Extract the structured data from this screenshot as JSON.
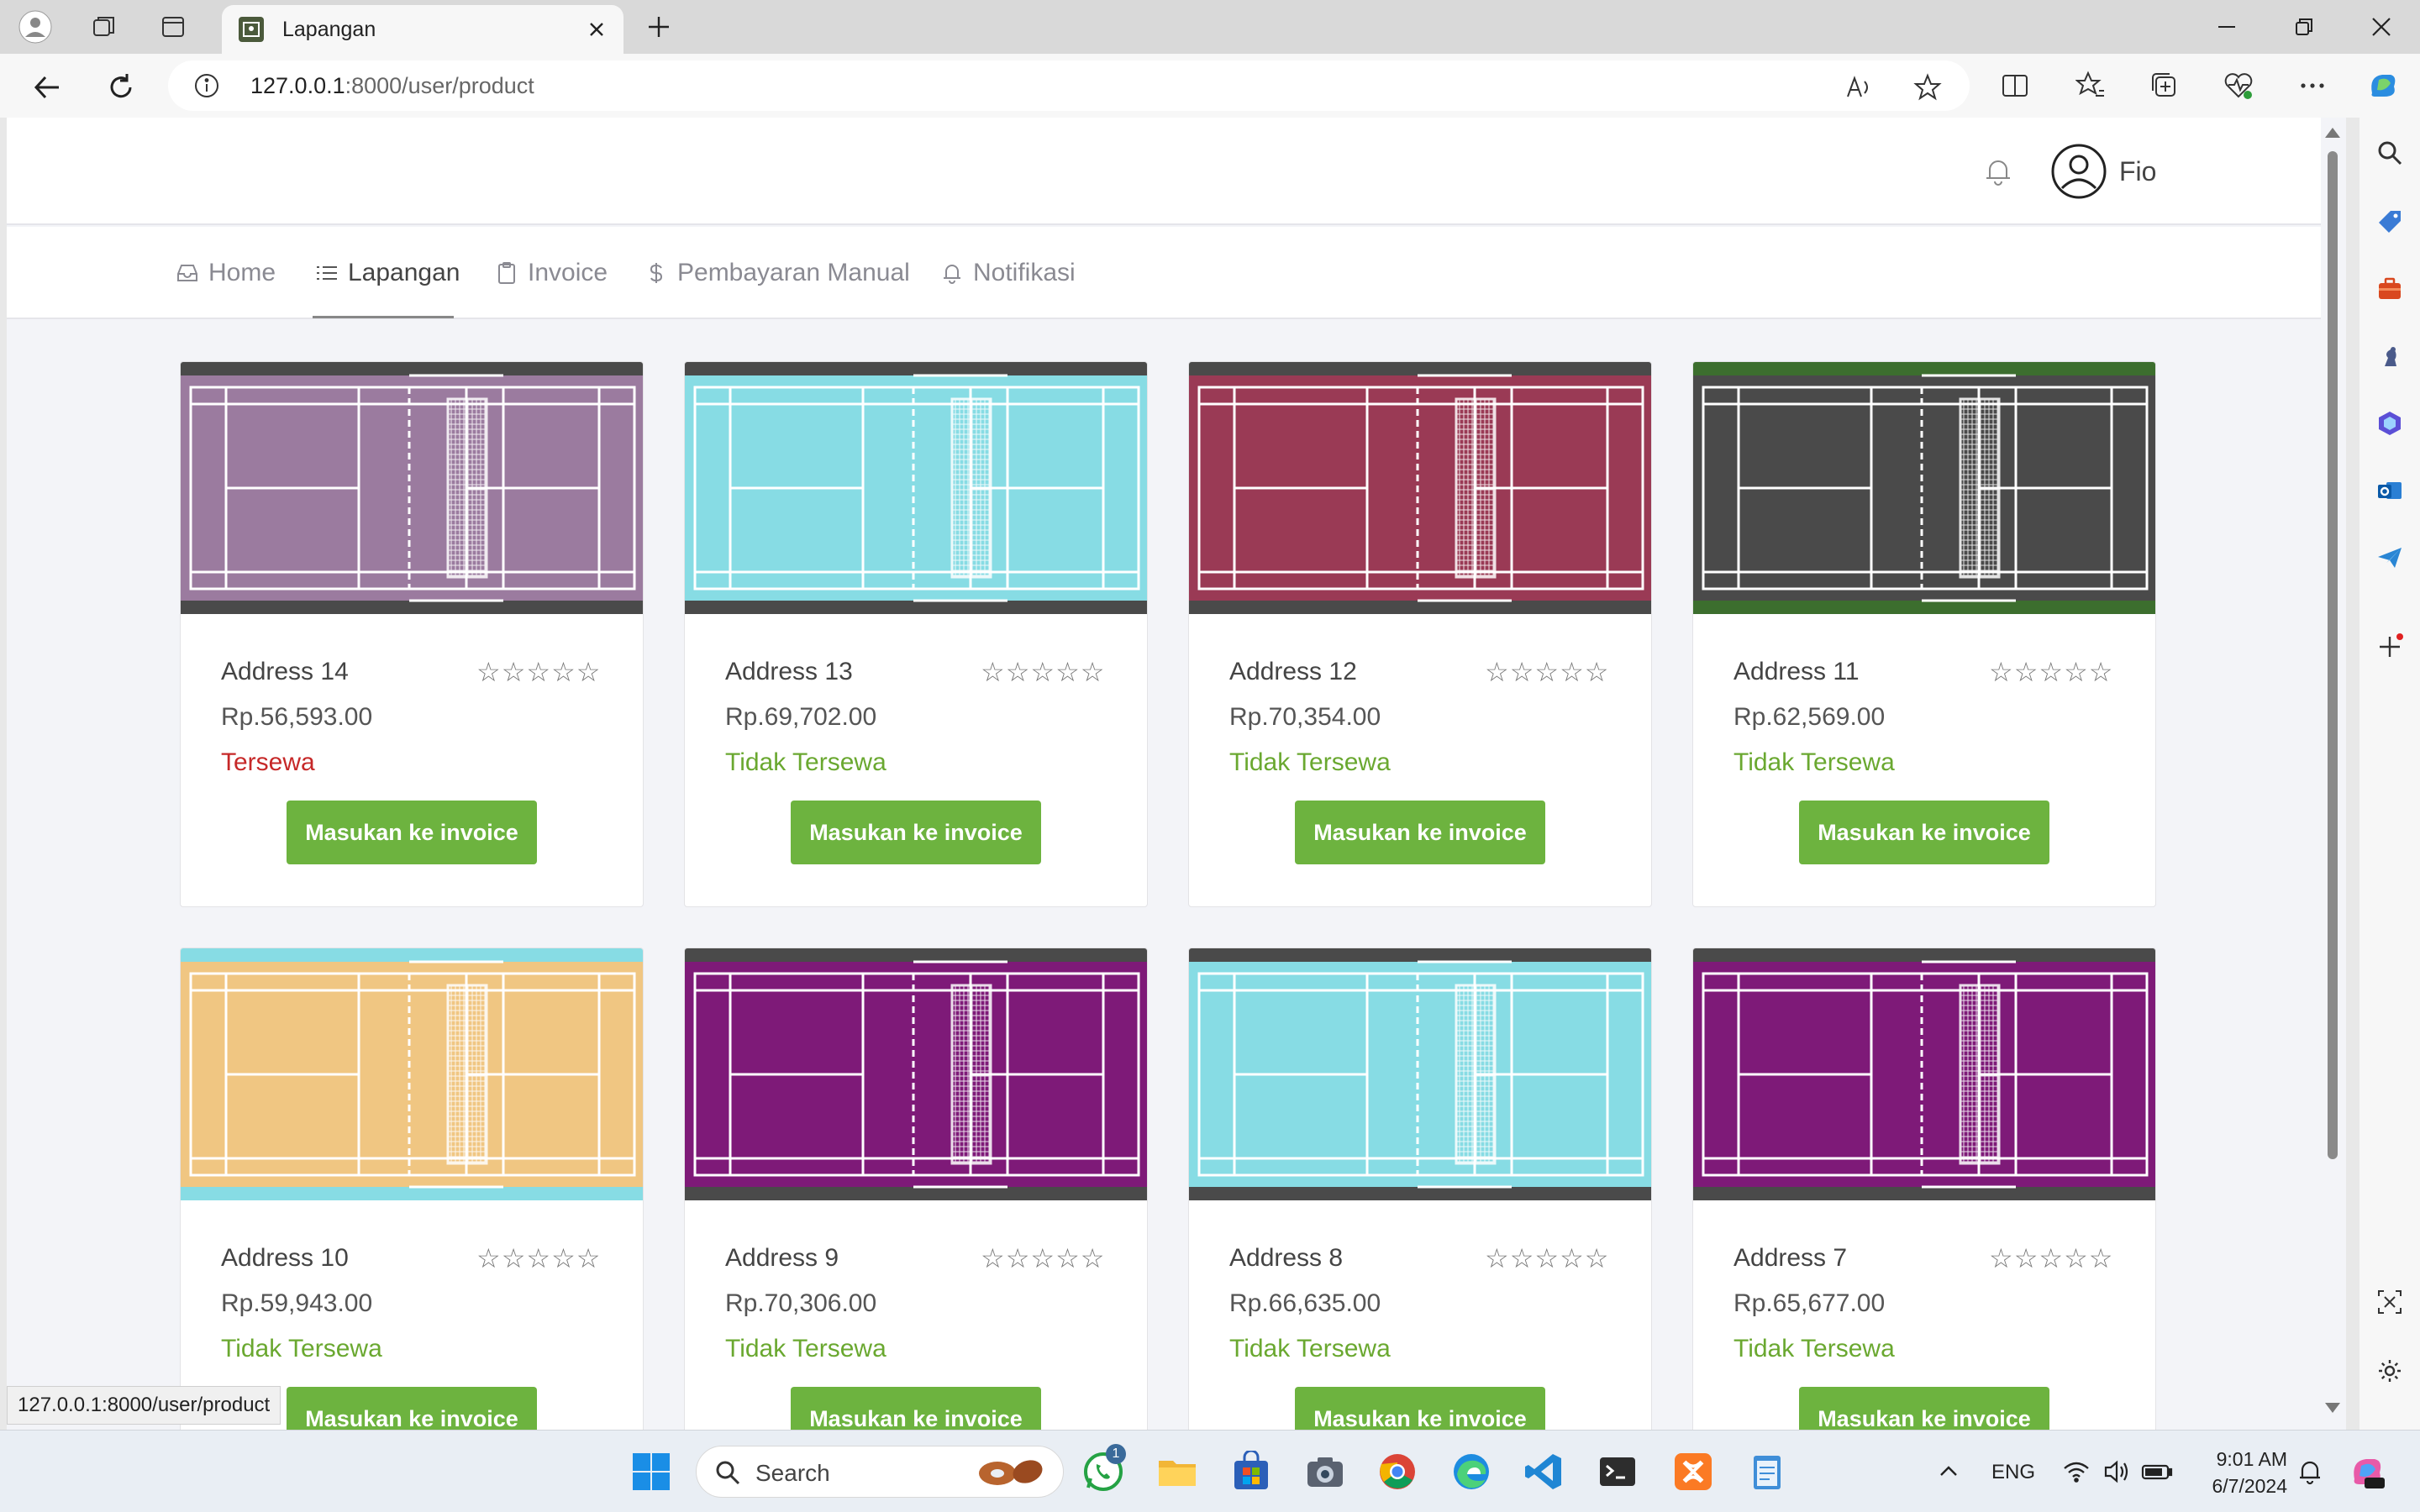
{
  "browser": {
    "tab_title": "Lapangan",
    "url_host": "127.0.0.1",
    "url_rest": ":8000/user/product",
    "status_url": "127.0.0.1:8000/user/product"
  },
  "header": {
    "user_name": "Fio"
  },
  "menu": {
    "items": [
      {
        "label": "Home",
        "icon": "inbox-icon"
      },
      {
        "label": "Lapangan",
        "icon": "list-icon"
      },
      {
        "label": "Invoice",
        "icon": "clipboard-icon"
      },
      {
        "label": "Pembayaran Manual",
        "icon": "dollar-icon"
      },
      {
        "label": "Notifikasi",
        "icon": "bell-icon"
      }
    ],
    "active": "Lapangan"
  },
  "products": [
    {
      "address": "Address 14",
      "price": "Rp.56,593.00",
      "status": "Tersewa",
      "rented": true,
      "court_color": "#9b7b9f",
      "edge_color": "#4a4a4a",
      "rating_stars": "☆☆☆☆☆",
      "button": "Masukan ke invoice"
    },
    {
      "address": "Address 13",
      "price": "Rp.69,702.00",
      "status": "Tidak Tersewa",
      "rented": false,
      "court_color": "#87dce4",
      "edge_color": "#4a4a4a",
      "rating_stars": "☆☆☆☆☆",
      "button": "Masukan ke invoice"
    },
    {
      "address": "Address 12",
      "price": "Rp.70,354.00",
      "status": "Tidak Tersewa",
      "rented": false,
      "court_color": "#9a3a55",
      "edge_color": "#4a4a4a",
      "rating_stars": "☆☆☆☆☆",
      "button": "Masukan ke invoice"
    },
    {
      "address": "Address 11",
      "price": "Rp.62,569.00",
      "status": "Tidak Tersewa",
      "rented": false,
      "court_color": "#4a4a4a",
      "edge_color": "#3c6e2e",
      "rating_stars": "☆☆☆☆☆",
      "button": "Masukan ke invoice"
    },
    {
      "address": "Address 10",
      "price": "Rp.59,943.00",
      "status": "Tidak Tersewa",
      "rented": false,
      "court_color": "#f0c682",
      "edge_color": "#87dce4",
      "rating_stars": "☆☆☆☆☆",
      "button": "Masukan ke invoice"
    },
    {
      "address": "Address 9",
      "price": "Rp.70,306.00",
      "status": "Tidak Tersewa",
      "rented": false,
      "court_color": "#7e1a78",
      "edge_color": "#4a4a4a",
      "rating_stars": "☆☆☆☆☆",
      "button": "Masukan ke invoice"
    },
    {
      "address": "Address 8",
      "price": "Rp.66,635.00",
      "status": "Tidak Tersewa",
      "rented": false,
      "court_color": "#87dce4",
      "edge_color": "#4a4a4a",
      "rating_stars": "☆☆☆☆☆",
      "button": "Masukan ke invoice"
    },
    {
      "address": "Address 7",
      "price": "Rp.65,677.00",
      "status": "Tidak Tersewa",
      "rented": false,
      "court_color": "#7e1a78",
      "edge_color": "#4a4a4a",
      "rating_stars": "☆☆☆☆☆",
      "button": "Masukan ke invoice"
    }
  ],
  "taskbar": {
    "search_label": "Search",
    "lang": "ENG",
    "time": "9:01 AM",
    "date": "6/7/2024",
    "whatsapp_badge": "1"
  },
  "colors": {
    "accent_green": "#6db33f",
    "status_available": "#6aa830",
    "status_rented": "#c62828"
  }
}
